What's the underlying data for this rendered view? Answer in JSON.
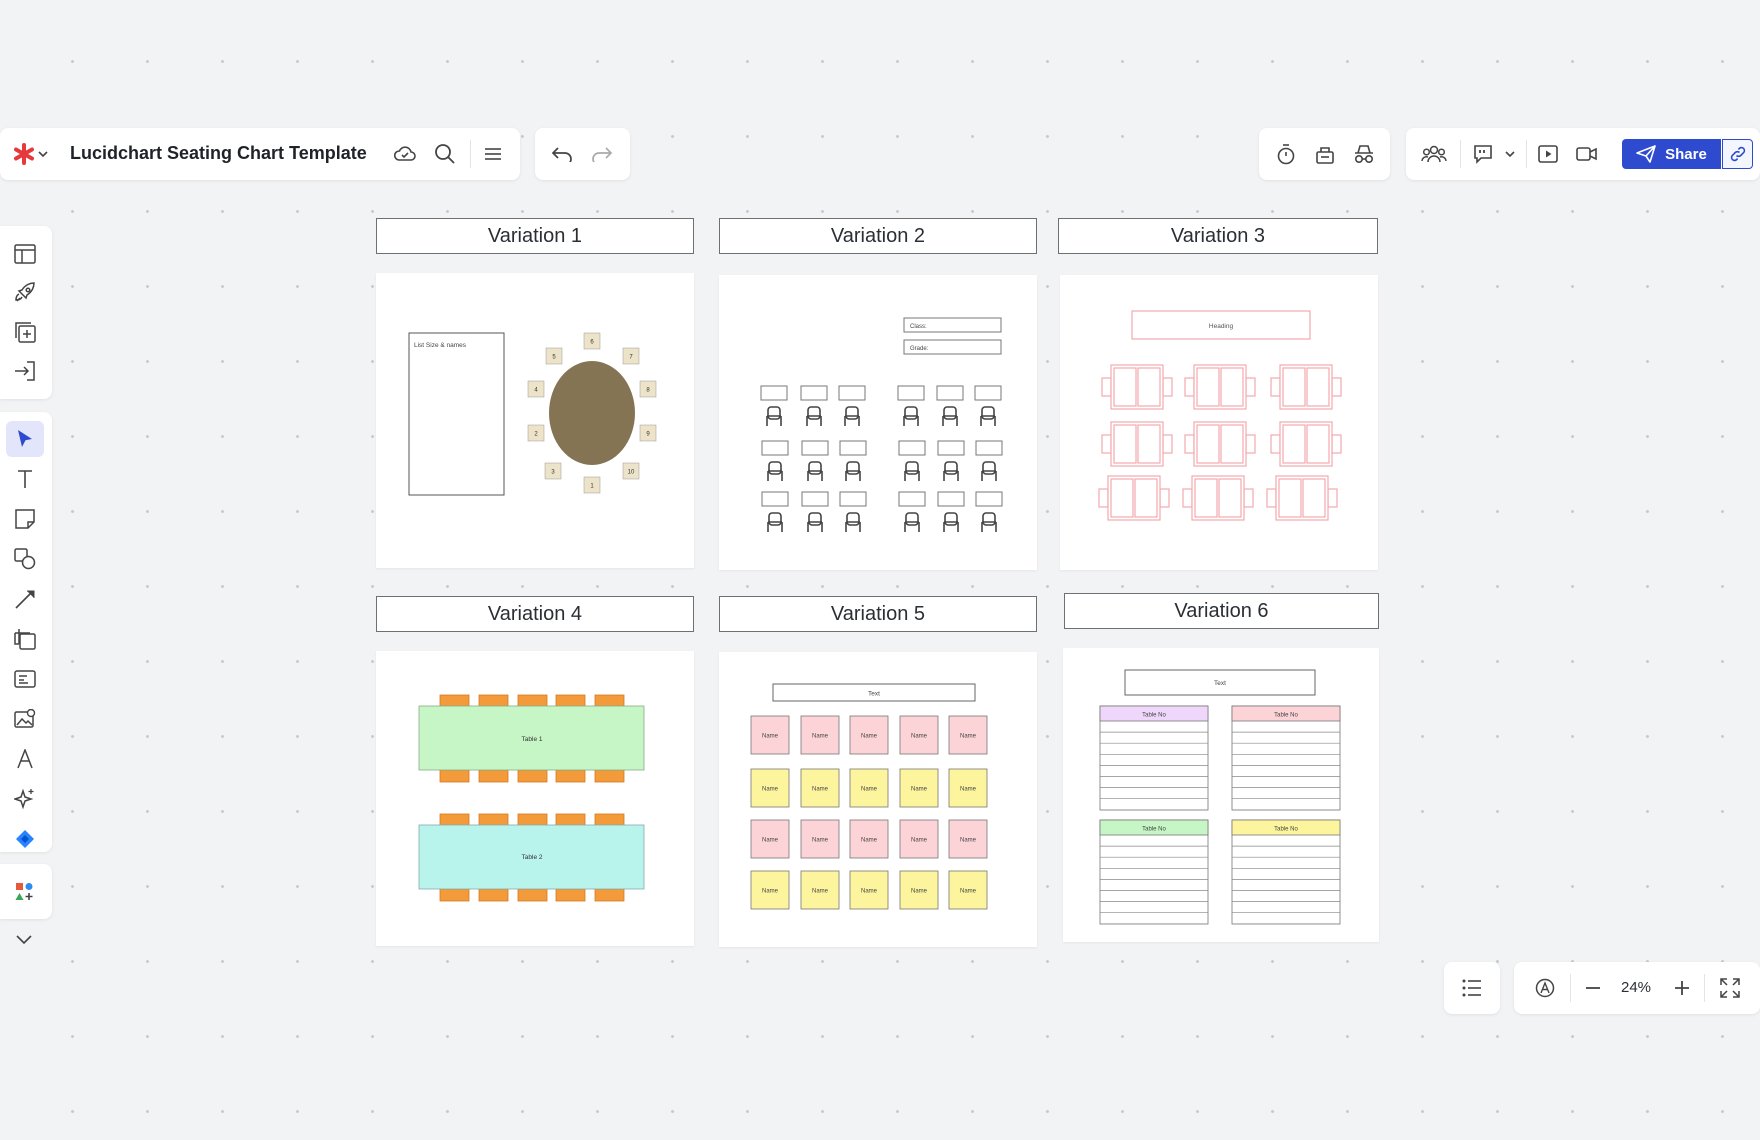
{
  "app": {
    "document_title": "Lucidchart Seating Chart Template",
    "share_label": "Share",
    "zoom_level": "24%",
    "accent_color": "#2e4bd0",
    "logo_color": "#e6393b"
  },
  "toolbar_icons": {
    "left": [
      "lucid-logo-icon",
      "chevron-down-icon",
      "cloud-saved-icon",
      "search-icon",
      "menu-icon",
      "undo-icon",
      "redo-icon"
    ],
    "right": [
      "timer-icon",
      "voting-icon",
      "incognito-icon",
      "collaborators-icon",
      "comment-icon",
      "chevron-down-icon",
      "present-icon",
      "video-call-icon",
      "send-icon",
      "link-icon"
    ]
  },
  "sidebar_icons": [
    "templates-icon",
    "rocket-icon",
    "add-frame-icon",
    "import-icon",
    "select-icon",
    "text-icon",
    "sticky-note-icon",
    "shapes-icon",
    "line-icon",
    "container-icon",
    "card-icon",
    "image-icon",
    "font-icon",
    "ai-sparkle-icon",
    "jira-icon",
    "more-shapes-icon",
    "expand-icon"
  ],
  "variations": [
    {
      "label": "Variation 1"
    },
    {
      "label": "Variation 2"
    },
    {
      "label": "Variation 3"
    },
    {
      "label": "Variation 4"
    },
    {
      "label": "Variation 5"
    },
    {
      "label": "Variation 6"
    }
  ],
  "v1": {
    "list_text": "List Size & names",
    "seats": [
      "1",
      "2",
      "3",
      "4",
      "5",
      "6",
      "7",
      "8",
      "9",
      "10"
    ],
    "seat_color": "#ece3c9",
    "table_color": "#857454"
  },
  "v2": {
    "field_1": "Class:",
    "field_2": "Grade:"
  },
  "v3": {
    "heading": "Heading",
    "stroke_color": "#f2a9ae"
  },
  "v4": {
    "table_1": "Table 1",
    "table_2": "Table 2",
    "chair_color": "#f39a3a",
    "table_1_color": "#c6f6c5",
    "table_2_color": "#b8f3ec"
  },
  "v5": {
    "title": "Text",
    "name": "Name",
    "pink": "#fcd3d6",
    "yellow": "#fdf59d"
  },
  "v6": {
    "title": "Text",
    "table_label": "Table No",
    "colors": [
      "#efd6fb",
      "#fcd3d6",
      "#c6f6c5",
      "#fdf59d"
    ]
  }
}
